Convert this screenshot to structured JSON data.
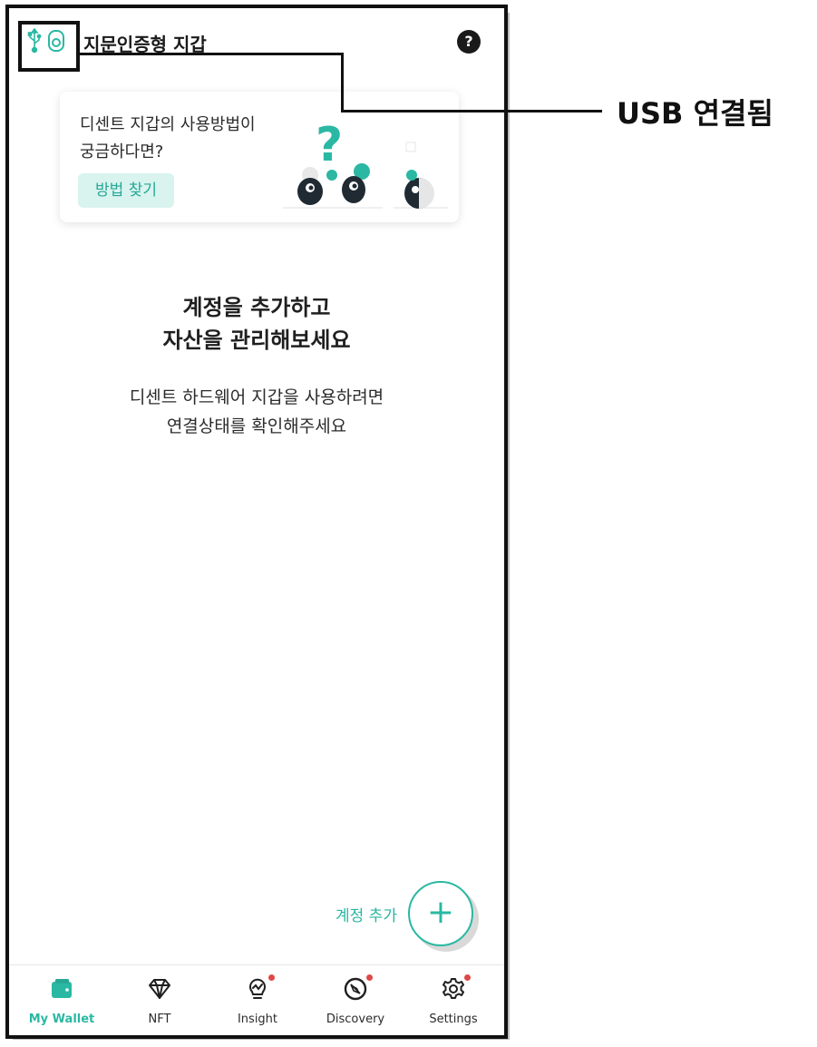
{
  "header": {
    "title": "지문인증형 지갑",
    "help_label": "?",
    "usb_icon": "usb-icon",
    "device_icon": "wallet-device-icon"
  },
  "banner": {
    "line1": "디센트 지갑의 사용방법이",
    "line2": "궁금하다면?",
    "button_label": "방법 찾기"
  },
  "empty_state": {
    "heading_line1": "계정을 추가하고",
    "heading_line2": "자산을 관리해보세요",
    "sub_line1": "디센트 하드웨어 지갑을 사용하려면",
    "sub_line2": "연결상태를 확인해주세요"
  },
  "fab": {
    "label": "계정 추가",
    "icon": "+"
  },
  "nav": {
    "items": [
      {
        "label": "My Wallet",
        "icon": "wallet-icon",
        "active": true,
        "badge": false
      },
      {
        "label": "NFT",
        "icon": "diamond-icon",
        "active": false,
        "badge": false
      },
      {
        "label": "Insight",
        "icon": "lightbulb-icon",
        "active": false,
        "badge": true
      },
      {
        "label": "Discovery",
        "icon": "compass-icon",
        "active": false,
        "badge": true
      },
      {
        "label": "Settings",
        "icon": "gear-icon",
        "active": false,
        "badge": true
      }
    ]
  },
  "annotation": {
    "text": "USB 연결됨"
  },
  "colors": {
    "accent": "#2ab8a3",
    "badge": "#e04848"
  }
}
